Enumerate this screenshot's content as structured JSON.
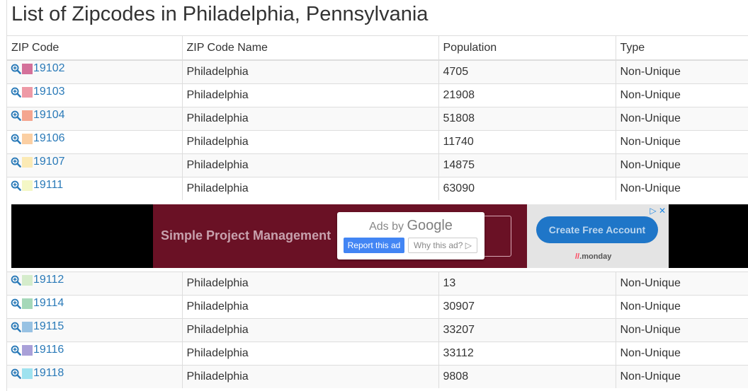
{
  "page": {
    "title": "List of Zipcodes in Philadelphia, Pennsylvania"
  },
  "table": {
    "columns": [
      "ZIP Code",
      "ZIP Code Name",
      "Population",
      "Type"
    ],
    "rows_top": [
      {
        "zip": "19102",
        "name": "Philadelphia",
        "population": "4705",
        "type": "Non-Unique",
        "color": "#d4719a"
      },
      {
        "zip": "19103",
        "name": "Philadelphia",
        "population": "21908",
        "type": "Non-Unique",
        "color": "#ee9aa6"
      },
      {
        "zip": "19104",
        "name": "Philadelphia",
        "population": "51808",
        "type": "Non-Unique",
        "color": "#f4a58f"
      },
      {
        "zip": "19106",
        "name": "Philadelphia",
        "population": "11740",
        "type": "Non-Unique",
        "color": "#fbcfa3"
      },
      {
        "zip": "19107",
        "name": "Philadelphia",
        "population": "14875",
        "type": "Non-Unique",
        "color": "#fbeab5"
      },
      {
        "zip": "19111",
        "name": "Philadelphia",
        "population": "63090",
        "type": "Non-Unique",
        "color": "#f4f7c6"
      }
    ],
    "rows_bottom": [
      {
        "zip": "19112",
        "name": "Philadelphia",
        "population": "13",
        "type": "Non-Unique",
        "color": "#d5eccb"
      },
      {
        "zip": "19114",
        "name": "Philadelphia",
        "population": "30907",
        "type": "Non-Unique",
        "color": "#a5d8b9"
      },
      {
        "zip": "19115",
        "name": "Philadelphia",
        "population": "33207",
        "type": "Non-Unique",
        "color": "#98c2e3"
      },
      {
        "zip": "19116",
        "name": "Philadelphia",
        "population": "33112",
        "type": "Non-Unique",
        "color": "#a9a0d8"
      },
      {
        "zip": "19118",
        "name": "Philadelphia",
        "population": "9808",
        "type": "Non-Unique",
        "color": "#9ee2ef"
      }
    ]
  },
  "ad": {
    "headline": "Simple Project Management",
    "cta": "Create Free Account",
    "brand": "monday",
    "ads_by_prefix": "Ads by",
    "ads_by_brand": "Google",
    "report_label": "Report this ad",
    "why_label": "Why this ad? ▷",
    "close_glyph": "▷ ✕"
  },
  "colors": {
    "link": "#2a7ab8",
    "row_stripe": "#f9f9f9",
    "border": "#dddddd"
  }
}
